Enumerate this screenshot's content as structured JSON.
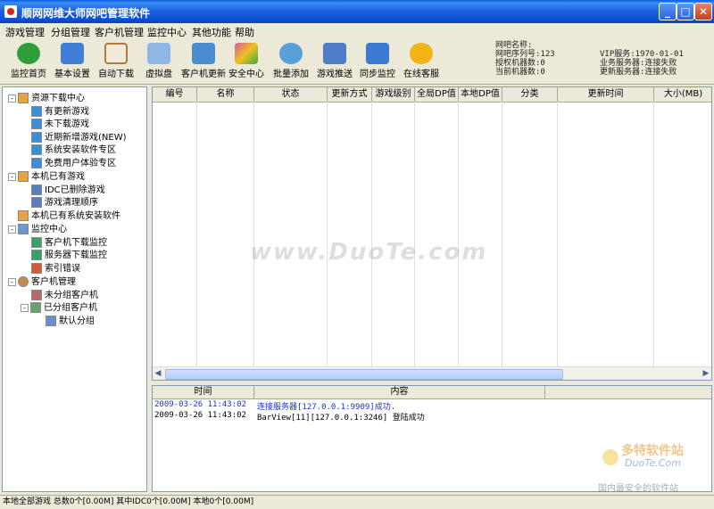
{
  "window": {
    "title": "顺网网维大师网吧管理软件",
    "buttons": {
      "minimize": "_",
      "maximize": "□",
      "close": "✕"
    }
  },
  "menu": [
    "游戏管理",
    "分组管理",
    "客户机管理",
    "监控中心",
    "其他功能",
    "帮助"
  ],
  "toolbar": [
    {
      "label": "监控首页",
      "icon": "monitor-home-icon",
      "color": "#2e9e3a"
    },
    {
      "label": "基本设置",
      "icon": "gear-icon",
      "color": "#3f7fd6"
    },
    {
      "label": "自动下载",
      "icon": "clock-icon",
      "color": "#b07a3a"
    },
    {
      "label": "虚拟盘",
      "icon": "disk-icon",
      "color": "#8fb7e6"
    },
    {
      "label": "客户机更新",
      "icon": "computer-icon",
      "color": "#4b8bd0"
    },
    {
      "label": "安全中心",
      "icon": "puzzle-icon",
      "color": "#d65a9c"
    },
    {
      "label": "批量添加",
      "icon": "magnifier-icon",
      "color": "#5aa0d8"
    },
    {
      "label": "游戏推送",
      "icon": "document-icon",
      "color": "#4e7ec8"
    },
    {
      "label": "同步监控",
      "icon": "sync-gear-icon",
      "color": "#3c7bd1"
    },
    {
      "label": "在线客服",
      "icon": "smiley-icon",
      "color": "#f2b417"
    }
  ],
  "info_left": [
    "网吧名称:",
    "网吧序列号:123",
    "授权机器数:0",
    "当前机器数:0"
  ],
  "info_right": [
    "VIP服务:1970-01-01",
    "业务服务器:连接失败",
    "更新服务器:连接失败"
  ],
  "tree": [
    {
      "label": "资源下载中心",
      "level": 0,
      "expander": "-",
      "icon": "folder-icon"
    },
    {
      "label": "有更新游戏",
      "level": 1,
      "icon": "update-icon"
    },
    {
      "label": "未下载游戏",
      "level": 1,
      "icon": "download-icon"
    },
    {
      "label": "近期新增游戏(NEW)",
      "level": 1,
      "icon": "new-icon"
    },
    {
      "label": "系统安装软件专区",
      "level": 1,
      "icon": "software-icon"
    },
    {
      "label": "免费用户体验专区",
      "level": 1,
      "icon": "free-icon"
    },
    {
      "label": "本机已有游戏",
      "level": 0,
      "expander": "-",
      "icon": "folder-icon"
    },
    {
      "label": "IDC已删除游戏",
      "level": 1,
      "icon": "deleted-icon"
    },
    {
      "label": "游戏清理顺序",
      "level": 1,
      "icon": "order-icon"
    },
    {
      "label": "本机已有系统安装软件",
      "level": 0,
      "expander": "",
      "icon": "folder-icon"
    },
    {
      "label": "监控中心",
      "level": 0,
      "expander": "-",
      "icon": "monitor-icon"
    },
    {
      "label": "客户机下载监控",
      "level": 1,
      "icon": "client-monitor-icon"
    },
    {
      "label": "服务器下载监控",
      "level": 1,
      "icon": "server-monitor-icon"
    },
    {
      "label": "索引错误",
      "level": 1,
      "icon": "error-icon"
    },
    {
      "label": "客户机管理",
      "level": 0,
      "expander": "-",
      "icon": "users-icon"
    },
    {
      "label": "未分组客户机",
      "level": 1,
      "icon": "ungrouped-icon"
    },
    {
      "label": "已分组客户机",
      "level": 1,
      "expander": "-",
      "icon": "grouped-icon"
    },
    {
      "label": "默认分组",
      "level": 2,
      "icon": "group-icon"
    }
  ],
  "grid_columns": [
    "编号",
    "名称",
    "状态",
    "更新方式",
    "游戏级别",
    "全局DP值",
    "本地DP值",
    "分类",
    "更新时间",
    "大小(MB)"
  ],
  "log_columns": [
    "时间",
    "内容"
  ],
  "log_rows": [
    {
      "time": "2009-03-26 11:43:02",
      "content": "连接服务器[127.0.0.1:9909]成功.",
      "color": "#1a33c9"
    },
    {
      "time": "2009-03-26 11:43:02",
      "content": "BarView[11][127.0.0.1:3246] 登陆成功",
      "color": "#000000"
    }
  ],
  "status": "本地全部游戏 总数0个[0.00M] 其中IDC0个[0.00M] 本地0个[0.00M]",
  "watermark": "www.DuoTe.com",
  "corner_watermark": {
    "line1": "多特软件站",
    "line2": "DuoTe.Com",
    "line3": "国内最安全的软件站"
  }
}
